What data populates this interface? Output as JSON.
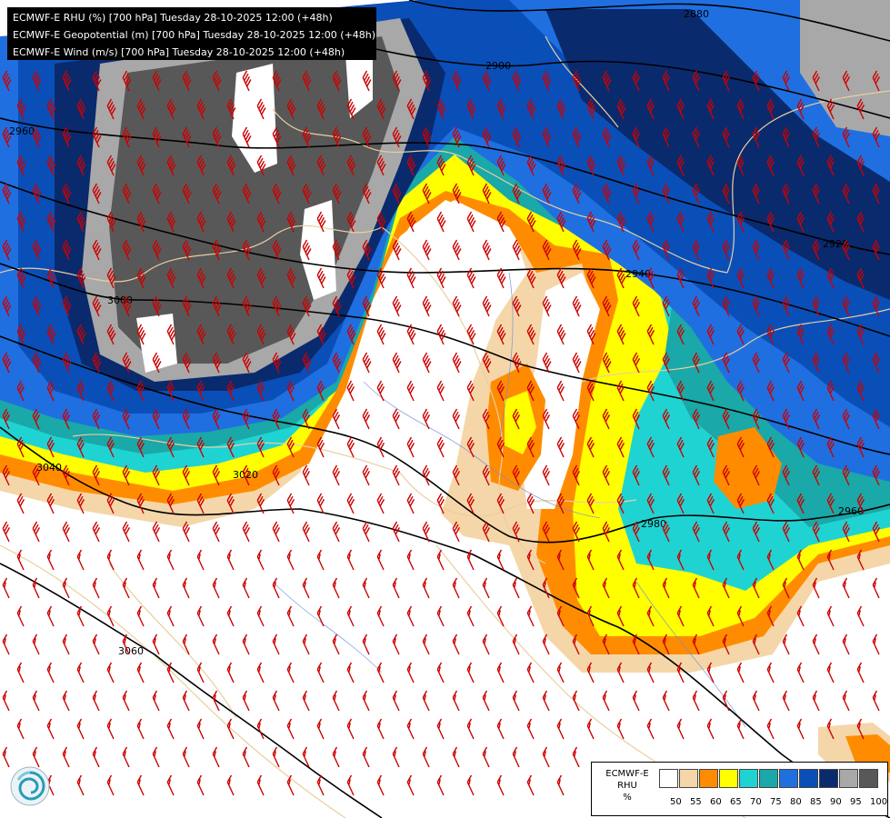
{
  "header": {
    "line1": "ECMWF-E RHU (%) [700 hPa] Tuesday 28-10-2025 12:00 (+48h)",
    "line2": "ECMWF-E Geopotential (m) [700 hPa] Tuesday 28-10-2025 12:00 (+48h)",
    "line3": "ECMWF-E Wind (m/s) [700 hPa] Tuesday 28-10-2025 12:00 (+48h)"
  },
  "legend": {
    "title_line1": "ECMWF-E",
    "title_line2": "RHU",
    "unit": "%",
    "colors": [
      "#ffffff",
      "#f5d6a8",
      "#ff8c00",
      "#ffff00",
      "#1fd3d3",
      "#1aa8a8",
      "#1f6fe0",
      "#0a4fb8",
      "#0a2a6e",
      "#a8a8a8",
      "#585858"
    ],
    "ticks": [
      "50",
      "55",
      "60",
      "65",
      "70",
      "75",
      "80",
      "85",
      "90",
      "95",
      "100"
    ]
  },
  "contours": {
    "labels": [
      "2880",
      "2900",
      "2960",
      "3000",
      "2920",
      "2940",
      "3040",
      "3020",
      "2980",
      "2960",
      "3060"
    ]
  },
  "colors": {
    "wind_barb": "#cc0000",
    "contour": "#000000",
    "border": "#e8cfa0"
  },
  "icons": {
    "logo": "meteo-logo-icon"
  }
}
